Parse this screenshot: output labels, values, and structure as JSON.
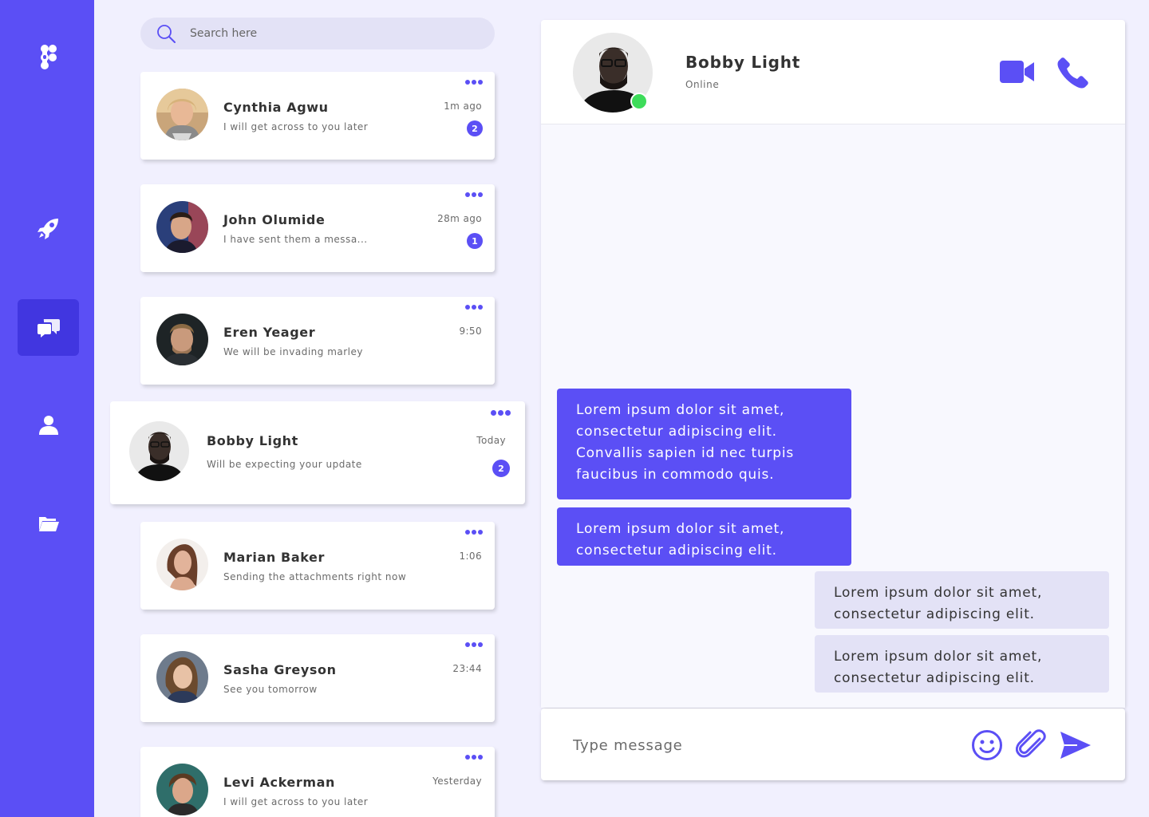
{
  "colors": {
    "accent": "#5b4ff5",
    "accent_dark": "#4136e0",
    "background": "#f1f0fe",
    "bubble_in": "#e3e2f6",
    "online": "#3ddc5a"
  },
  "sidebar": {
    "items": [
      {
        "icon": "app-logo-icon"
      },
      {
        "icon": "rocket-icon"
      },
      {
        "icon": "chat-icon",
        "active": true
      },
      {
        "icon": "user-icon"
      },
      {
        "icon": "folder-icon"
      }
    ]
  },
  "search": {
    "placeholder": "Search here"
  },
  "contacts": [
    {
      "name": "Cynthia Agwu",
      "message": "I will get across to you later",
      "time": "1m ago",
      "unread": "2"
    },
    {
      "name": "John Olumide",
      "message": "I have sent them a messa...",
      "time": "28m ago",
      "unread": "1"
    },
    {
      "name": "Eren Yeager",
      "message": "We will be invading marley",
      "time": "9:50",
      "unread": ""
    },
    {
      "name": "Bobby Light",
      "message": "Will be expecting your update",
      "time": "Today",
      "unread": "2",
      "selected": true
    },
    {
      "name": "Marian Baker",
      "message": "Sending the attachments right now",
      "time": "1:06",
      "unread": ""
    },
    {
      "name": "Sasha Greyson",
      "message": "See you tomorrow",
      "time": "23:44",
      "unread": ""
    },
    {
      "name": "Levi Ackerman",
      "message": "I will get across to you later",
      "time": "Yesterday",
      "unread": ""
    }
  ],
  "chat": {
    "contact_name": "Bobby Light",
    "status": "Online",
    "messages": [
      {
        "direction": "out",
        "text": "Lorem ipsum dolor sit amet, consectetur adipiscing elit. Convallis sapien id nec turpis faucibus in commodo quis."
      },
      {
        "direction": "out",
        "text": "Lorem ipsum dolor sit amet, consectetur adipiscing elit."
      },
      {
        "direction": "in",
        "text": "Lorem ipsum dolor sit amet, consectetur adipiscing elit."
      },
      {
        "direction": "in",
        "text": "Lorem ipsum dolor sit amet, consectetur adipiscing elit."
      }
    ]
  },
  "composer": {
    "placeholder": "Type message"
  }
}
